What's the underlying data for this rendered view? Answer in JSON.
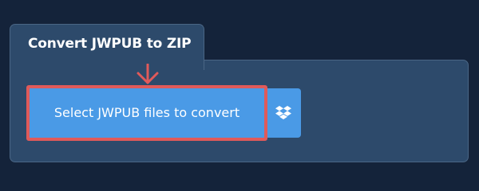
{
  "converter": {
    "title": "Convert JWPUB to ZIP",
    "select_button_label": "Select JWPUB files to convert",
    "dropbox_icon": "dropbox-icon",
    "arrow_icon": "down-arrow-icon"
  },
  "colors": {
    "page_background": "#14233a",
    "panel_background": "#2d4a6b",
    "button_background": "#4a9ae6",
    "highlight": "#e05a5a"
  }
}
